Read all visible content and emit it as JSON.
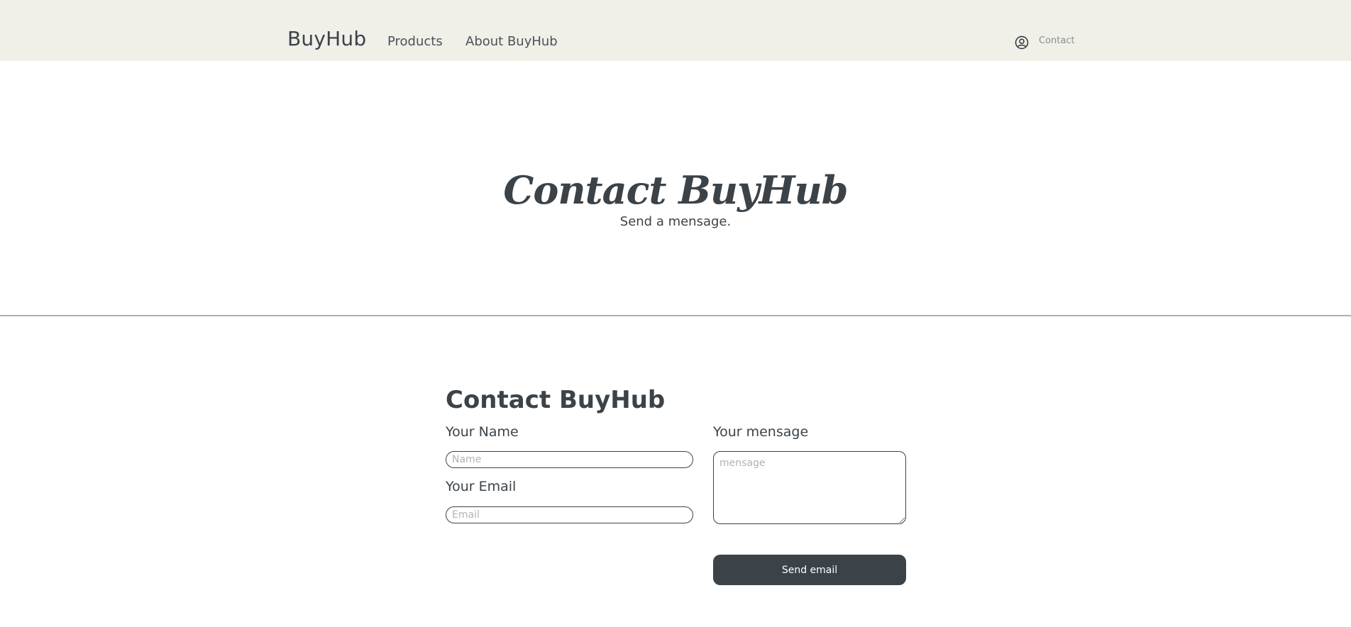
{
  "header": {
    "brand": "BuyHub",
    "nav": {
      "products": "Products",
      "about": "About BuyHub"
    },
    "user_icon": "user-circle-icon",
    "contact": "Contact",
    "background": "#f0efe8"
  },
  "hero": {
    "title": "Contact BuyHub",
    "subtitle": "Send a mensage."
  },
  "form": {
    "title": "Contact BuyHub",
    "name_label": "Your Name",
    "name_placeholder": "Name",
    "email_label": "Your Email",
    "email_placeholder": "Email",
    "message_label": "Your mensage",
    "message_placeholder": "mensage",
    "submit_label": "Send email"
  },
  "colors": {
    "primary": "#3b4349",
    "divider": "#a9afbb"
  }
}
